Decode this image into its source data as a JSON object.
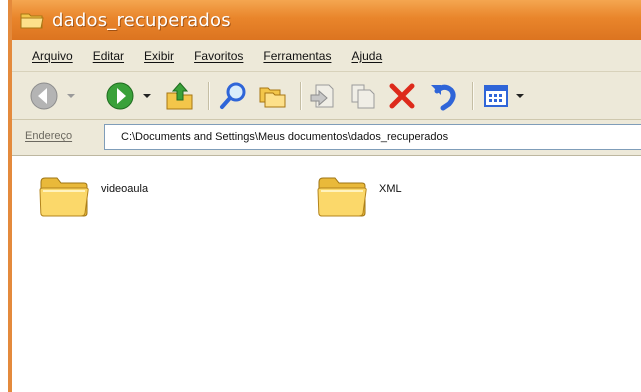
{
  "window": {
    "title": "dados_recuperados",
    "title_icon": "folder-icon"
  },
  "menubar": {
    "items": [
      {
        "label": "Arquivo"
      },
      {
        "label": "Editar"
      },
      {
        "label": "Exibir"
      },
      {
        "label": "Favoritos"
      },
      {
        "label": "Ferramentas"
      },
      {
        "label": "Ajuda"
      }
    ]
  },
  "toolbar": {
    "buttons": [
      {
        "icon": "back-arrow-icon"
      },
      {
        "icon": "forward-arrow-icon"
      },
      {
        "icon": "up-folder-icon"
      },
      {
        "icon": "search-icon"
      },
      {
        "icon": "folders-icon"
      },
      {
        "icon": "move-to-icon"
      },
      {
        "icon": "copy-to-icon"
      },
      {
        "icon": "delete-icon"
      },
      {
        "icon": "undo-icon"
      },
      {
        "icon": "views-icon"
      }
    ]
  },
  "address": {
    "label": "Endereço",
    "value": "C:\\Documents and Settings\\Meus documentos\\dados_recuperados"
  },
  "files": [
    {
      "name": "videoaula",
      "icon": "folder-icon"
    },
    {
      "name": "XML",
      "icon": "folder-icon"
    }
  ],
  "colors": {
    "titlebar": "#e9852b",
    "chrome": "#ede9d9",
    "back_disabled": "#a6a6a6",
    "forward": "#3aa13a",
    "delete": "#dd2a1b",
    "undo": "#2f65d8",
    "folder": "#f6d35b"
  }
}
